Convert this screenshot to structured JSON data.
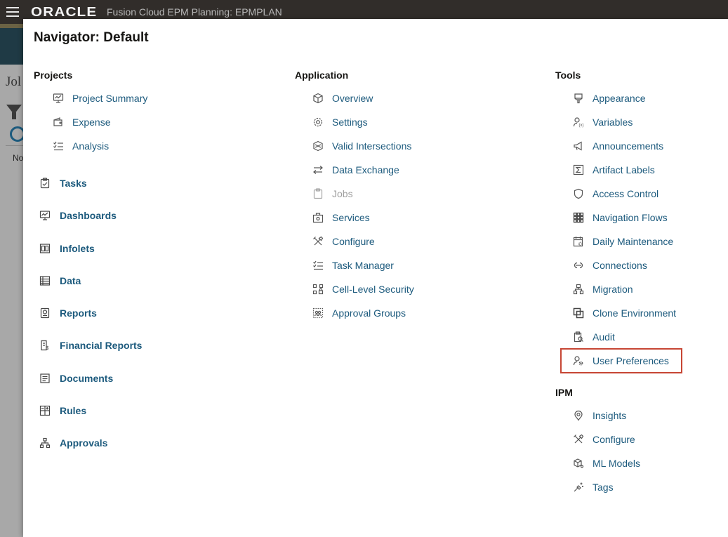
{
  "header": {
    "menu_icon": "hamburger-icon",
    "logo": "ORACLE",
    "app_title": "Fusion Cloud EPM Planning:  EPMPLAN"
  },
  "background": {
    "page_label": "Jol",
    "status": "No"
  },
  "navigator": {
    "title": "Navigator: Default",
    "projects": {
      "header": "Projects",
      "items": [
        {
          "label": "Project Summary",
          "icon": "monitor-chart-icon"
        },
        {
          "label": "Expense",
          "icon": "wallet-icon"
        },
        {
          "label": "Analysis",
          "icon": "checklist-icon"
        }
      ]
    },
    "cards": [
      {
        "label": "Tasks",
        "icon": "clipboard-check-icon"
      },
      {
        "label": "Dashboards",
        "icon": "monitor-chart-icon"
      },
      {
        "label": "Infolets",
        "icon": "infolet-icon"
      },
      {
        "label": "Data",
        "icon": "table-icon"
      },
      {
        "label": "Reports",
        "icon": "report-icon"
      },
      {
        "label": "Financial Reports",
        "icon": "financial-report-icon"
      },
      {
        "label": "Documents",
        "icon": "document-icon"
      },
      {
        "label": "Rules",
        "icon": "calculator-icon"
      },
      {
        "label": "Approvals",
        "icon": "hierarchy-icon"
      }
    ],
    "application": {
      "header": "Application",
      "items": [
        {
          "label": "Overview",
          "icon": "cube-icon"
        },
        {
          "label": "Settings",
          "icon": "gear-icon"
        },
        {
          "label": "Valid Intersections",
          "icon": "intersect-icon"
        },
        {
          "label": "Data Exchange",
          "icon": "exchange-icon"
        },
        {
          "label": "Jobs",
          "icon": "clipboard-icon",
          "disabled": true
        },
        {
          "label": "Services",
          "icon": "briefcase-gear-icon"
        },
        {
          "label": "Configure",
          "icon": "tools-icon"
        },
        {
          "label": "Task Manager",
          "icon": "checklist-icon"
        },
        {
          "label": "Cell-Level Security",
          "icon": "grid-lock-icon"
        },
        {
          "label": "Approval Groups",
          "icon": "group-icon"
        }
      ]
    },
    "tools": {
      "header": "Tools",
      "items": [
        {
          "label": "Appearance",
          "icon": "paint-brush-icon"
        },
        {
          "label": "Variables",
          "icon": "user-variable-icon"
        },
        {
          "label": "Announcements",
          "icon": "megaphone-icon"
        },
        {
          "label": "Artifact Labels",
          "icon": "sigma-icon"
        },
        {
          "label": "Access Control",
          "icon": "shield-icon"
        },
        {
          "label": "Navigation Flows",
          "icon": "grid-flow-icon"
        },
        {
          "label": "Daily Maintenance",
          "icon": "calendar-gear-icon"
        },
        {
          "label": "Connections",
          "icon": "connection-icon"
        },
        {
          "label": "Migration",
          "icon": "migration-icon"
        },
        {
          "label": "Clone Environment",
          "icon": "clone-icon"
        },
        {
          "label": "Audit",
          "icon": "audit-icon"
        },
        {
          "label": "User Preferences",
          "icon": "user-settings-icon",
          "highlighted": true
        }
      ]
    },
    "ipm": {
      "header": "IPM",
      "items": [
        {
          "label": "Insights",
          "icon": "insight-icon"
        },
        {
          "label": "Configure",
          "icon": "tools-icon"
        },
        {
          "label": "ML Models",
          "icon": "ml-cube-icon"
        },
        {
          "label": "Tags",
          "icon": "tag-spark-icon"
        }
      ]
    },
    "colors": {
      "link": "#1c5a7d",
      "header_bg": "#312d2a",
      "highlight_border": "#c74634",
      "disabled": "#9e9e9e"
    }
  }
}
